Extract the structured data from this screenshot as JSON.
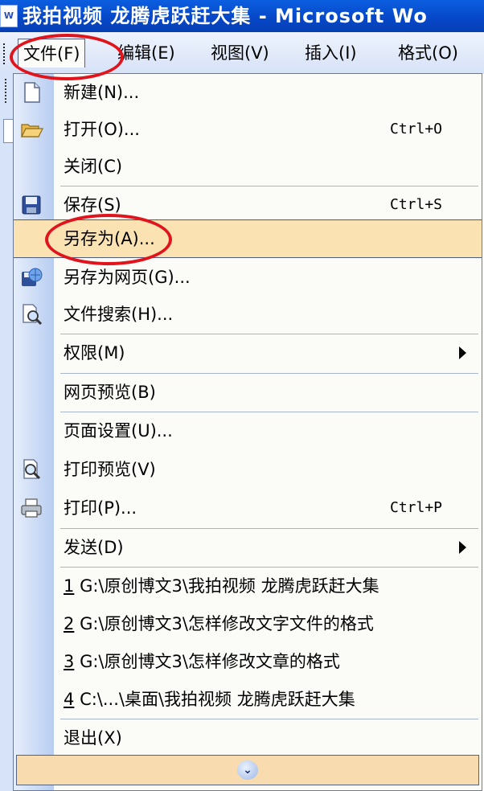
{
  "window": {
    "title": "我拍视频 龙腾虎跃赶大集 - Microsoft Wo",
    "icon": "word-doc-icon"
  },
  "menubar": {
    "items": [
      {
        "label": "文件(F)",
        "open": true
      },
      {
        "label": "编辑(E)"
      },
      {
        "label": "视图(V)"
      },
      {
        "label": "插入(I)"
      },
      {
        "label": "格式(O)"
      }
    ]
  },
  "file_menu": {
    "items": [
      {
        "label": "新建(N)...",
        "shortcut": "",
        "icon": "new-document-icon"
      },
      {
        "label": "打开(O)...",
        "shortcut": "Ctrl+O",
        "icon": "open-folder-icon"
      },
      {
        "label": "关闭(C)",
        "shortcut": "",
        "icon": ""
      },
      {
        "label": "保存(S)",
        "shortcut": "Ctrl+S",
        "icon": "save-disk-icon"
      },
      {
        "label": "另存为(A)...",
        "shortcut": "",
        "icon": "",
        "highlighted": true
      },
      {
        "label": "另存为网页(G)...",
        "shortcut": "",
        "icon": "save-as-webpage-icon"
      },
      {
        "label": "文件搜索(H)...",
        "shortcut": "",
        "icon": "file-search-icon"
      },
      {
        "label": "权限(M)",
        "shortcut": "",
        "icon": "",
        "submenu": true
      },
      {
        "label": "网页预览(B)",
        "shortcut": "",
        "icon": ""
      },
      {
        "label": "页面设置(U)...",
        "shortcut": "",
        "icon": ""
      },
      {
        "label": "打印预览(V)",
        "shortcut": "",
        "icon": "print-preview-icon"
      },
      {
        "label": "打印(P)...",
        "shortcut": "Ctrl+P",
        "icon": "printer-icon"
      },
      {
        "label": "发送(D)",
        "shortcut": "",
        "icon": "",
        "submenu": true
      }
    ],
    "recent_files": [
      {
        "number": "1",
        "path": "G:\\原创博文3\\我拍视频 龙腾虎跃赶大集"
      },
      {
        "number": "2",
        "path": "G:\\原创博文3\\怎样修改文字文件的格式"
      },
      {
        "number": "3",
        "path": "G:\\原创博文3\\怎样修改文章的格式"
      },
      {
        "number": "4",
        "path": "C:\\...\\桌面\\我拍视频 龙腾虎跃赶大集"
      }
    ],
    "exit_label": "退出(X)",
    "expand_icon": "chevron-double-down-icon"
  },
  "annotations": {
    "ring_color": "#e0141c"
  },
  "colors": {
    "highlight": "#fbe2b2",
    "titlebar": "#0648c9",
    "gutter": "#b8cdf1"
  }
}
